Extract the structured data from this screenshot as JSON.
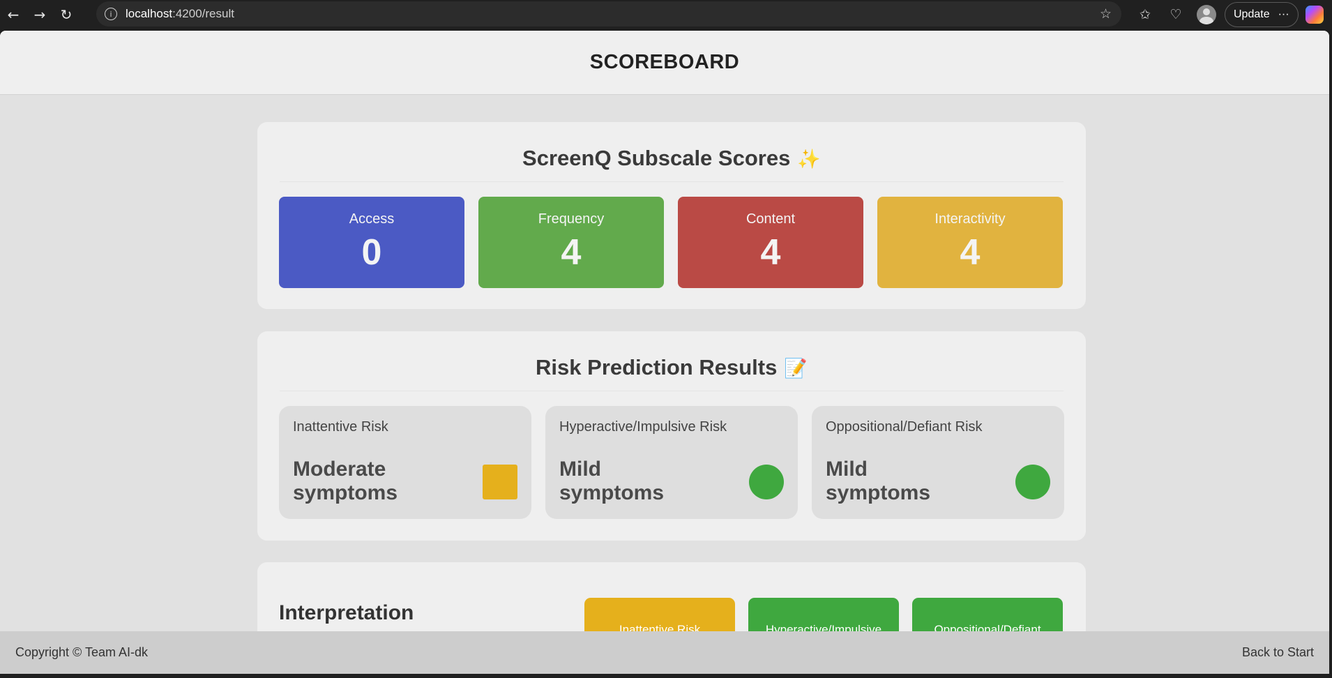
{
  "browser": {
    "url_host": "localhost",
    "url_path": ":4200/result",
    "update_label": "Update"
  },
  "header": {
    "title": "SCOREBOARD"
  },
  "subscale": {
    "title": "ScreenQ Subscale Scores",
    "emoji": "✨",
    "scores": [
      {
        "label": "Access",
        "value": "0",
        "color": "#4b5ac4"
      },
      {
        "label": "Frequency",
        "value": "4",
        "color": "#62aa4c"
      },
      {
        "label": "Content",
        "value": "4",
        "color": "#ba4a45"
      },
      {
        "label": "Interactivity",
        "value": "4",
        "color": "#e1b33f"
      }
    ]
  },
  "risk": {
    "title": "Risk Prediction Results",
    "emoji": "📝",
    "items": [
      {
        "name": "Inattentive Risk",
        "level": "Moderate symptoms",
        "indicator": "square",
        "color": "#e5b01c"
      },
      {
        "name": "Hyperactive/Impulsive Risk",
        "level": "Mild symptoms",
        "indicator": "circle",
        "color": "#3fa83f"
      },
      {
        "name": "Oppositional/Defiant Risk",
        "level": "Mild symptoms",
        "indicator": "circle",
        "color": "#3fa83f"
      }
    ]
  },
  "interpretation": {
    "title": "Interpretation",
    "legend": [
      {
        "label": "Inattentive Risk",
        "color": "#e5b01c"
      },
      {
        "label": "Hyperactive/Impulsive",
        "color": "#3fa83f"
      },
      {
        "label": "Oppositional/Defiant",
        "color": "#3fa83f"
      }
    ]
  },
  "footer": {
    "copyright": "Copyright © Team AI-dk",
    "back_label": "Back to Start"
  }
}
